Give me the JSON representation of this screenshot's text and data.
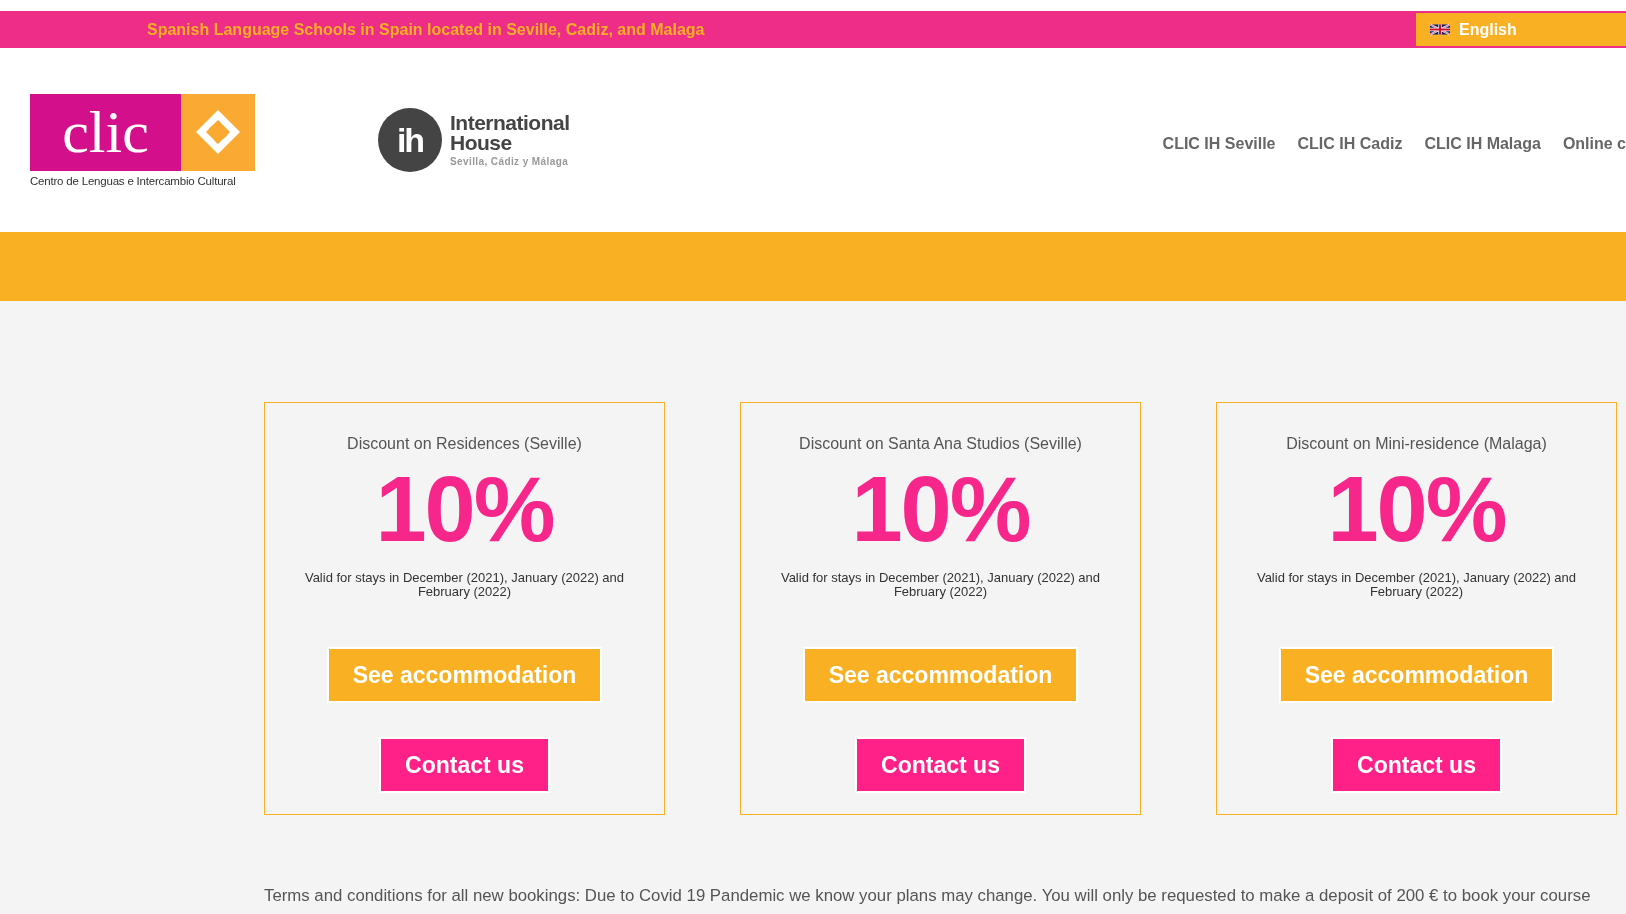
{
  "top_bar": {
    "tagline": "Spanish Language Schools in Spain located in Seville, Cadiz, and Malaga",
    "language": "English"
  },
  "header": {
    "clic_logo": {
      "wordmark": "clic",
      "subtitle": "Centro de Lenguas e Intercambio Cultural"
    },
    "ih_logo": {
      "mark": "ih",
      "line_1": "International",
      "line_2": "House",
      "line_3": "Sevilla, Cádiz y Málaga"
    },
    "nav": [
      "CLIC IH Seville",
      "CLIC IH Cadiz",
      "CLIC IH Malaga",
      "Online c"
    ]
  },
  "offers": [
    {
      "title": "Discount on Residences (Seville)",
      "discount": "10%",
      "validity": "Valid for stays in December (2021), January (2022) and February (2022)",
      "buttons": [
        "See accommodation",
        "Contact us"
      ]
    },
    {
      "title": "Discount on Santa Ana Studios (Seville)",
      "discount": "10%",
      "validity": "Valid for stays in December (2021), January (2022) and February (2022)",
      "buttons": [
        "See accommodation",
        "Contact us"
      ]
    },
    {
      "title": "Discount on Mini-residence (Malaga)",
      "discount": "10%",
      "validity": "Valid for stays in December (2021), January (2022) and February (2022)",
      "buttons": [
        "See accommodation",
        "Contact us"
      ]
    }
  ],
  "terms": "Terms and conditions for all new bookings: Due to Covid 19 Pandemic we know your plans may change. You will only be requested to make a deposit of 200 € to book your course"
}
